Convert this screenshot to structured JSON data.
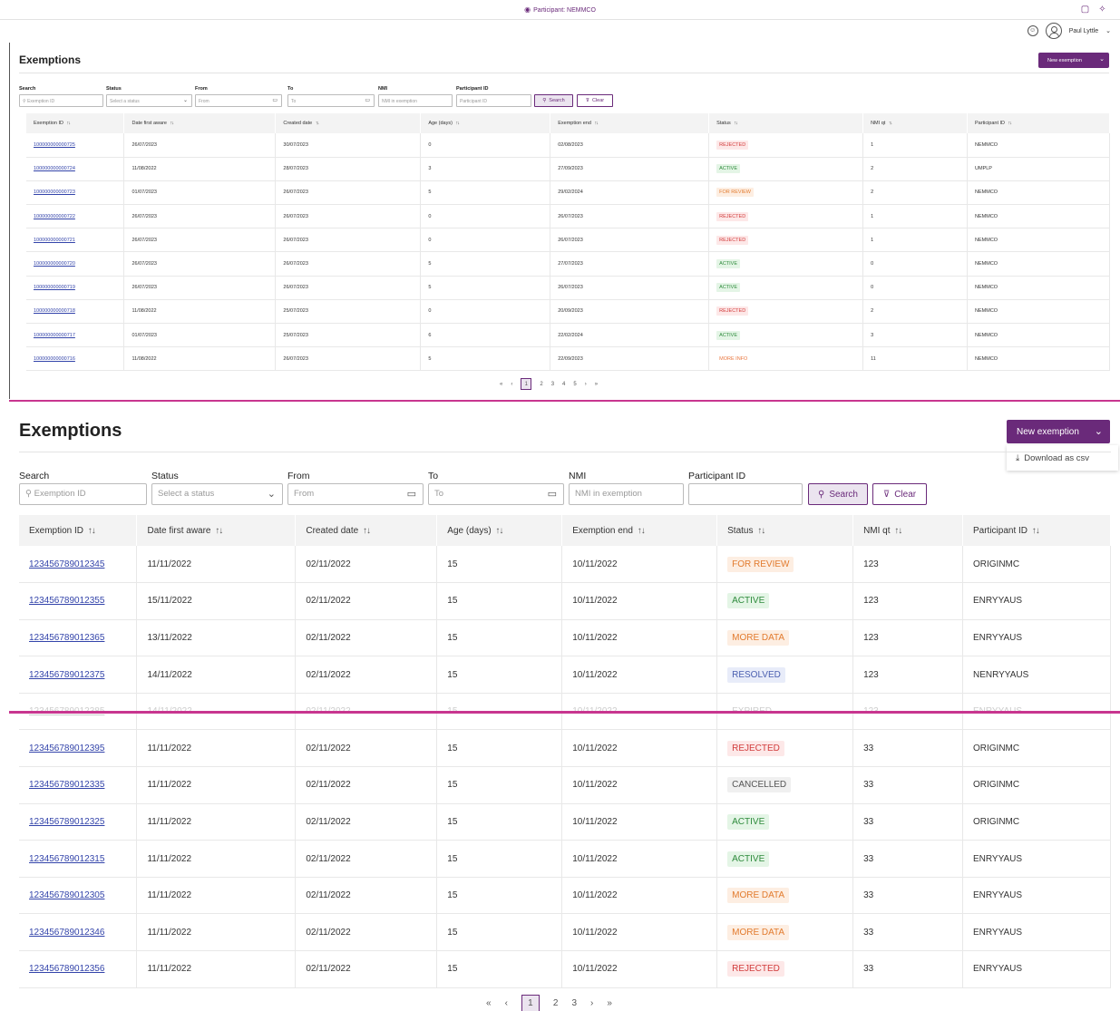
{
  "topbar": {
    "participant_label": "Participant: NEMMCO",
    "user_name": "Paul Lyttle",
    "icons": [
      "eye-icon",
      "document-icon",
      "settings-icon",
      "face-icon",
      "user-avatar-icon",
      "chevron-down-icon"
    ]
  },
  "panel1": {
    "title": "Exemptions",
    "new_button": "New exemption",
    "filters": {
      "search_label": "Search",
      "search_placeholder": "Exemption ID",
      "status_label": "Status",
      "status_placeholder": "Select a status",
      "from_label": "From",
      "from_placeholder": "From",
      "to_label": "To",
      "to_placeholder": "To",
      "nmi_label": "NMI",
      "nmi_placeholder": "NMI in exemption",
      "participant_label": "Participant ID",
      "participant_placeholder": "Participant ID",
      "search_button": "Search",
      "clear_button": "Clear"
    },
    "columns": [
      "Exemption ID",
      "Date first aware",
      "Created date",
      "Age (days)",
      "Exemption end",
      "Status",
      "NMI qt",
      "Participant ID"
    ],
    "rows": [
      [
        "100000000000725",
        "26/07/2023",
        "30/07/2023",
        "0",
        "02/08/2023",
        "REJECTED",
        "1",
        "NEMMCO"
      ],
      [
        "100000000000724",
        "11/08/2022",
        "28/07/2023",
        "3",
        "27/09/2023",
        "ACTIVE",
        "2",
        "UMPLP"
      ],
      [
        "100000000000723",
        "01/07/2023",
        "26/07/2023",
        "5",
        "29/02/2024",
        "FOR REVIEW",
        "2",
        "NEMMCO"
      ],
      [
        "100000000000722",
        "26/07/2023",
        "26/07/2023",
        "0",
        "26/07/2023",
        "REJECTED",
        "1",
        "NEMMCO"
      ],
      [
        "100000000000721",
        "26/07/2023",
        "26/07/2023",
        "0",
        "26/07/2023",
        "REJECTED",
        "1",
        "NEMMCO"
      ],
      [
        "100000000000720",
        "26/07/2023",
        "26/07/2023",
        "5",
        "27/07/2023",
        "ACTIVE",
        "0",
        "NEMMCO"
      ],
      [
        "100000000000719",
        "26/07/2023",
        "26/07/2023",
        "5",
        "26/07/2023",
        "ACTIVE",
        "0",
        "NEMMCO"
      ],
      [
        "100000000000718",
        "11/08/2022",
        "25/07/2023",
        "0",
        "20/09/2023",
        "REJECTED",
        "2",
        "NEMMCO"
      ],
      [
        "100000000000717",
        "01/07/2023",
        "25/07/2023",
        "6",
        "22/02/2024",
        "ACTIVE",
        "3",
        "NEMMCO"
      ],
      [
        "100000000000716",
        "11/08/2022",
        "26/07/2023",
        "5",
        "22/09/2023",
        "MORE INFO",
        "11",
        "NEMMCO"
      ]
    ],
    "pager": {
      "first": "«",
      "prev": "‹",
      "pages": [
        "1",
        "2",
        "3",
        "4",
        "5"
      ],
      "next": "›",
      "last": "»"
    }
  },
  "panel2": {
    "title": "Exemptions",
    "new_button": "New exemption",
    "dropdown_item": "Download as csv",
    "filters": {
      "search_label": "Search",
      "search_placeholder": "Exemption ID",
      "status_label": "Status",
      "status_placeholder": "Select a status",
      "from_label": "From",
      "from_placeholder": "From",
      "to_label": "To",
      "to_placeholder": "To",
      "nmi_label": "NMI",
      "nmi_placeholder": "NMI in exemption",
      "participant_label": "Participant ID",
      "participant_placeholder": "",
      "search_button": "Search",
      "clear_button": "Clear"
    },
    "columns": [
      "Exemption ID",
      "Date first aware",
      "Created date",
      "Age (days)",
      "Exemption end",
      "Status",
      "NMI qt",
      "Participant ID"
    ],
    "rows": [
      [
        "123456789012345",
        "11/11/2022",
        "02/11/2022",
        "15",
        "10/11/2022",
        "FOR REVIEW",
        "123",
        "ORIGINMC"
      ],
      [
        "123456789012355",
        "15/11/2022",
        "02/11/2022",
        "15",
        "10/11/2022",
        "ACTIVE",
        "123",
        "ENRYYAUS"
      ],
      [
        "123456789012365",
        "13/11/2022",
        "02/11/2022",
        "15",
        "10/11/2022",
        "MORE DATA",
        "123",
        "ENRYYAUS"
      ],
      [
        "123456789012375",
        "14/11/2022",
        "02/11/2022",
        "15",
        "10/11/2022",
        "RESOLVED",
        "123",
        "NENRYYAUS"
      ],
      [
        "123456789012385",
        "14/11/2022",
        "02/11/2022",
        "15",
        "10/11/2022",
        "EXPIRED",
        "123",
        "ENRYYAUS"
      ],
      [
        "123456789012395",
        "11/11/2022",
        "02/11/2022",
        "15",
        "10/11/2022",
        "REJECTED",
        "33",
        "ORIGINMC"
      ],
      [
        "123456789012335",
        "11/11/2022",
        "02/11/2022",
        "15",
        "10/11/2022",
        "CANCELLED",
        "33",
        "ORIGINMC"
      ],
      [
        "123456789012325",
        "11/11/2022",
        "02/11/2022",
        "15",
        "10/11/2022",
        "ACTIVE",
        "33",
        "ORIGINMC"
      ],
      [
        "123456789012315",
        "11/11/2022",
        "02/11/2022",
        "15",
        "10/11/2022",
        "ACTIVE",
        "33",
        "ENRYYAUS"
      ],
      [
        "123456789012305",
        "11/11/2022",
        "02/11/2022",
        "15",
        "10/11/2022",
        "MORE DATA",
        "33",
        "ENRYYAUS"
      ],
      [
        "123456789012346",
        "11/11/2022",
        "02/11/2022",
        "15",
        "10/11/2022",
        "MORE DATA",
        "33",
        "ENRYYAUS"
      ],
      [
        "123456789012356",
        "11/11/2022",
        "02/11/2022",
        "15",
        "10/11/2022",
        "REJECTED",
        "33",
        "ENRYYAUS"
      ]
    ],
    "pager": {
      "first": "«",
      "prev": "‹",
      "pages": [
        "1",
        "2",
        "3"
      ],
      "next": "›",
      "last": "»"
    }
  },
  "status_colors": {
    "REJECTED": "#d23b3b",
    "ACTIVE": "#2e8b3c",
    "FOR REVIEW": "#e27b2e",
    "MORE INFO": "#e9763f",
    "MORE DATA": "#e9763f",
    "RESOLVED": "#4b5fb0",
    "CANCELLED": "#555555",
    "EXPIRED": "#cccccc"
  },
  "accent_color": "#6a2a7a"
}
